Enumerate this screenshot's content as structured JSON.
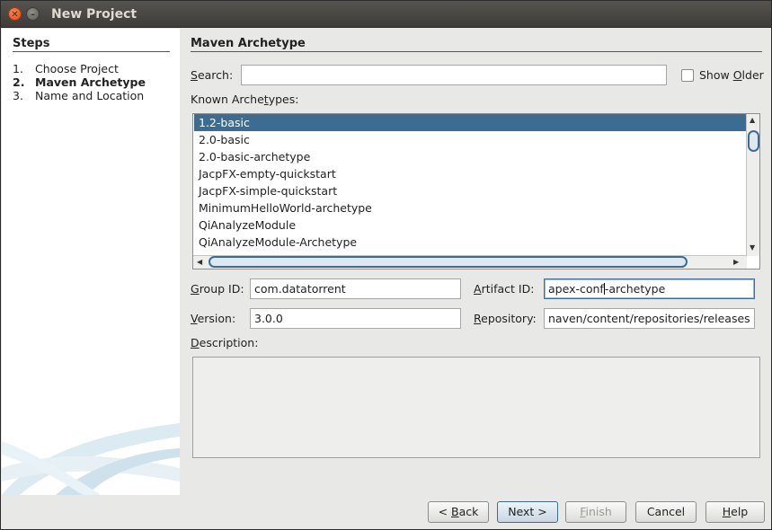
{
  "window": {
    "title": "New Project"
  },
  "steps": {
    "heading": "Steps",
    "items": [
      {
        "num": "1.",
        "label": "Choose Project"
      },
      {
        "num": "2.",
        "label": "Maven Archetype"
      },
      {
        "num": "3.",
        "label": "Name and Location"
      }
    ]
  },
  "panel": {
    "heading": "Maven Archetype",
    "search": {
      "label_mnemonic": "S",
      "label_rest": "earch:",
      "value": ""
    },
    "show_older": {
      "label_pre": "Show ",
      "label_mnemonic": "O",
      "label_rest": "lder",
      "checked": false
    },
    "known": {
      "label_pre": "Known Arche",
      "label_mnemonic": "t",
      "label_rest": "ypes:"
    },
    "archetypes": [
      "1.2-basic",
      "2.0-basic",
      "2.0-basic-archetype",
      "JacpFX-empty-quickstart",
      "JacpFX-simple-quickstart",
      "MinimumHelloWorld-archetype",
      "QiAnalyzeModule",
      "QiAnalyzeModule-Archetype"
    ],
    "selected_index": 0,
    "group_id": {
      "label_mnemonic": "G",
      "label_rest": "roup ID:",
      "value": "com.datatorrent"
    },
    "artifact_id": {
      "label_mnemonic": "A",
      "label_rest": "rtifact ID:",
      "value_before_caret": "apex-conf",
      "value_after_caret": "-archetype"
    },
    "version": {
      "label_mnemonic": "V",
      "label_rest": "ersion:",
      "value": "3.0.0"
    },
    "repository": {
      "label_mnemonic": "R",
      "label_rest": "epository:",
      "value": "naven/content/repositories/releases"
    },
    "description": {
      "label_mnemonic": "D",
      "label_rest": "escription:",
      "value": ""
    }
  },
  "buttons": {
    "back": {
      "pre": "< ",
      "mnemonic": "B",
      "rest": "ack"
    },
    "next": {
      "label": "Next >"
    },
    "finish": {
      "mnemonic": "F",
      "rest": "inish"
    },
    "cancel": {
      "label": "Cancel"
    },
    "help": {
      "mnemonic": "H",
      "rest": "elp"
    }
  },
  "icons": {
    "close": "close-icon",
    "minimize": "minimize-icon"
  },
  "colors": {
    "selection": "#3d6c92",
    "titlebar": "#3d3c38",
    "close": "#df4a16"
  }
}
